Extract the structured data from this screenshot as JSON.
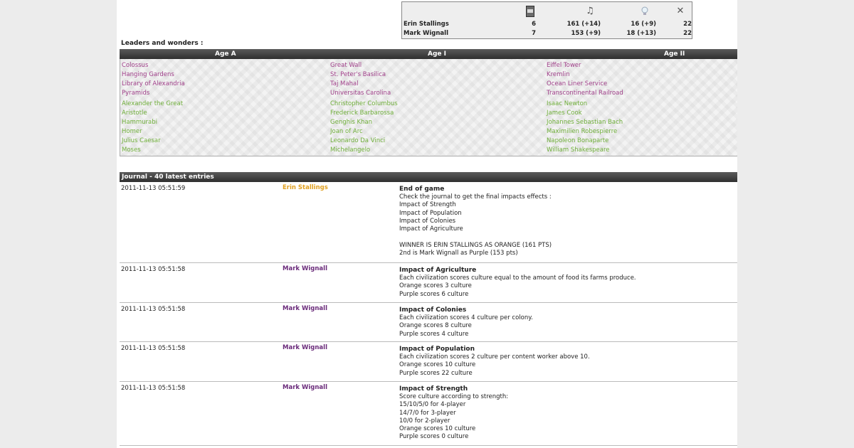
{
  "score_table": {
    "icons": [
      "card-icon",
      "music-note-icon",
      "lightbulb-icon",
      "crossed-swords-icon"
    ],
    "players": [
      {
        "name": "Erin Stallings",
        "c1": "6",
        "c2": "161 (+14)",
        "c3": "16 (+9)",
        "c4": "22"
      },
      {
        "name": "Mark Wignall",
        "c1": "7",
        "c2": "153 (+9)",
        "c3": "18 (+13)",
        "c4": "22"
      }
    ]
  },
  "leaders_title": "Leaders and wonders :",
  "ages": [
    "Age A",
    "Age I",
    "Age II"
  ],
  "wonders": {
    "age_a": [
      "Colossus",
      "Hanging Gardens",
      "Library of Alexandria",
      "Pyramids"
    ],
    "age_i": [
      "Great Wall",
      "St. Peter's Basilica",
      "Taj Mahal",
      "Universitas Carolina"
    ],
    "age_ii": [
      "Eiffel Tower",
      "Kremlin",
      "Ocean Liner Service",
      "Transcontinental Railroad"
    ]
  },
  "leaders": {
    "age_a": [
      "Alexander the Great",
      "Aristotle",
      "Hammurabi",
      "Homer",
      "Julius Caesar",
      "Moses"
    ],
    "age_i": [
      "Christopher Columbus",
      "Frederick Barbarossa",
      "Genghis Khan",
      "Joan of Arc",
      "Leonardo Da Vinci",
      "Michelangelo"
    ],
    "age_ii": [
      "Isaac Newton",
      "James Cook",
      "Johannes Sebastian Bach",
      "Maximilien Robespierre",
      "Napoleon Bonaparte",
      "William Shakespeare"
    ]
  },
  "journal_title": "Journal - 40 latest entries",
  "journal": [
    {
      "date": "2011-11-13 05:51:59",
      "player": "Erin Stallings",
      "color": "orange",
      "title": "End of game",
      "lines": [
        "Check the journal to get the final impacts effects :",
        "Impact of Strength",
        "Impact of Population",
        "Impact of Colonies",
        "Impact of Agriculture",
        "",
        "WINNER IS ERIN STALLINGS AS ORANGE (161 PTS)",
        "2nd is Mark Wignall as Purple (153 pts)"
      ]
    },
    {
      "date": "2011-11-13 05:51:58",
      "player": "Mark Wignall",
      "color": "purple",
      "title": "Impact of Agriculture",
      "lines": [
        "Each civilization scores culture equal to the amount of food its farms produce.",
        "Orange scores 3 culture",
        "Purple scores 6 culture"
      ]
    },
    {
      "date": "2011-11-13 05:51:58",
      "player": "Mark Wignall",
      "color": "purple",
      "title": "Impact of Colonies",
      "lines": [
        "Each civilization scores 4 culture per colony.",
        "Orange scores 8 culture",
        "Purple scores 4 culture"
      ]
    },
    {
      "date": "2011-11-13 05:51:58",
      "player": "Mark Wignall",
      "color": "purple",
      "title": "Impact of Population",
      "lines": [
        "Each civilization scores 2 culture per content worker above 10.",
        "Orange scores 10 culture",
        "Purple scores 22 culture"
      ]
    },
    {
      "date": "2011-11-13 05:51:58",
      "player": "Mark Wignall",
      "color": "purple",
      "title": "Impact of Strength",
      "lines": [
        "Score culture according to strength:",
        "15/10/5/0 for 4-player",
        "14/7/0 for 3-player",
        "10/0 for 2-player",
        "Orange scores 10 culture",
        "Purple scores 0 culture"
      ]
    }
  ],
  "colors": {
    "wonder": "#a0408a",
    "leader": "#6fae3a",
    "orange_player": "#e0a020",
    "purple_player": "#6a2a7a",
    "header_bg": "#3a3a3a"
  }
}
